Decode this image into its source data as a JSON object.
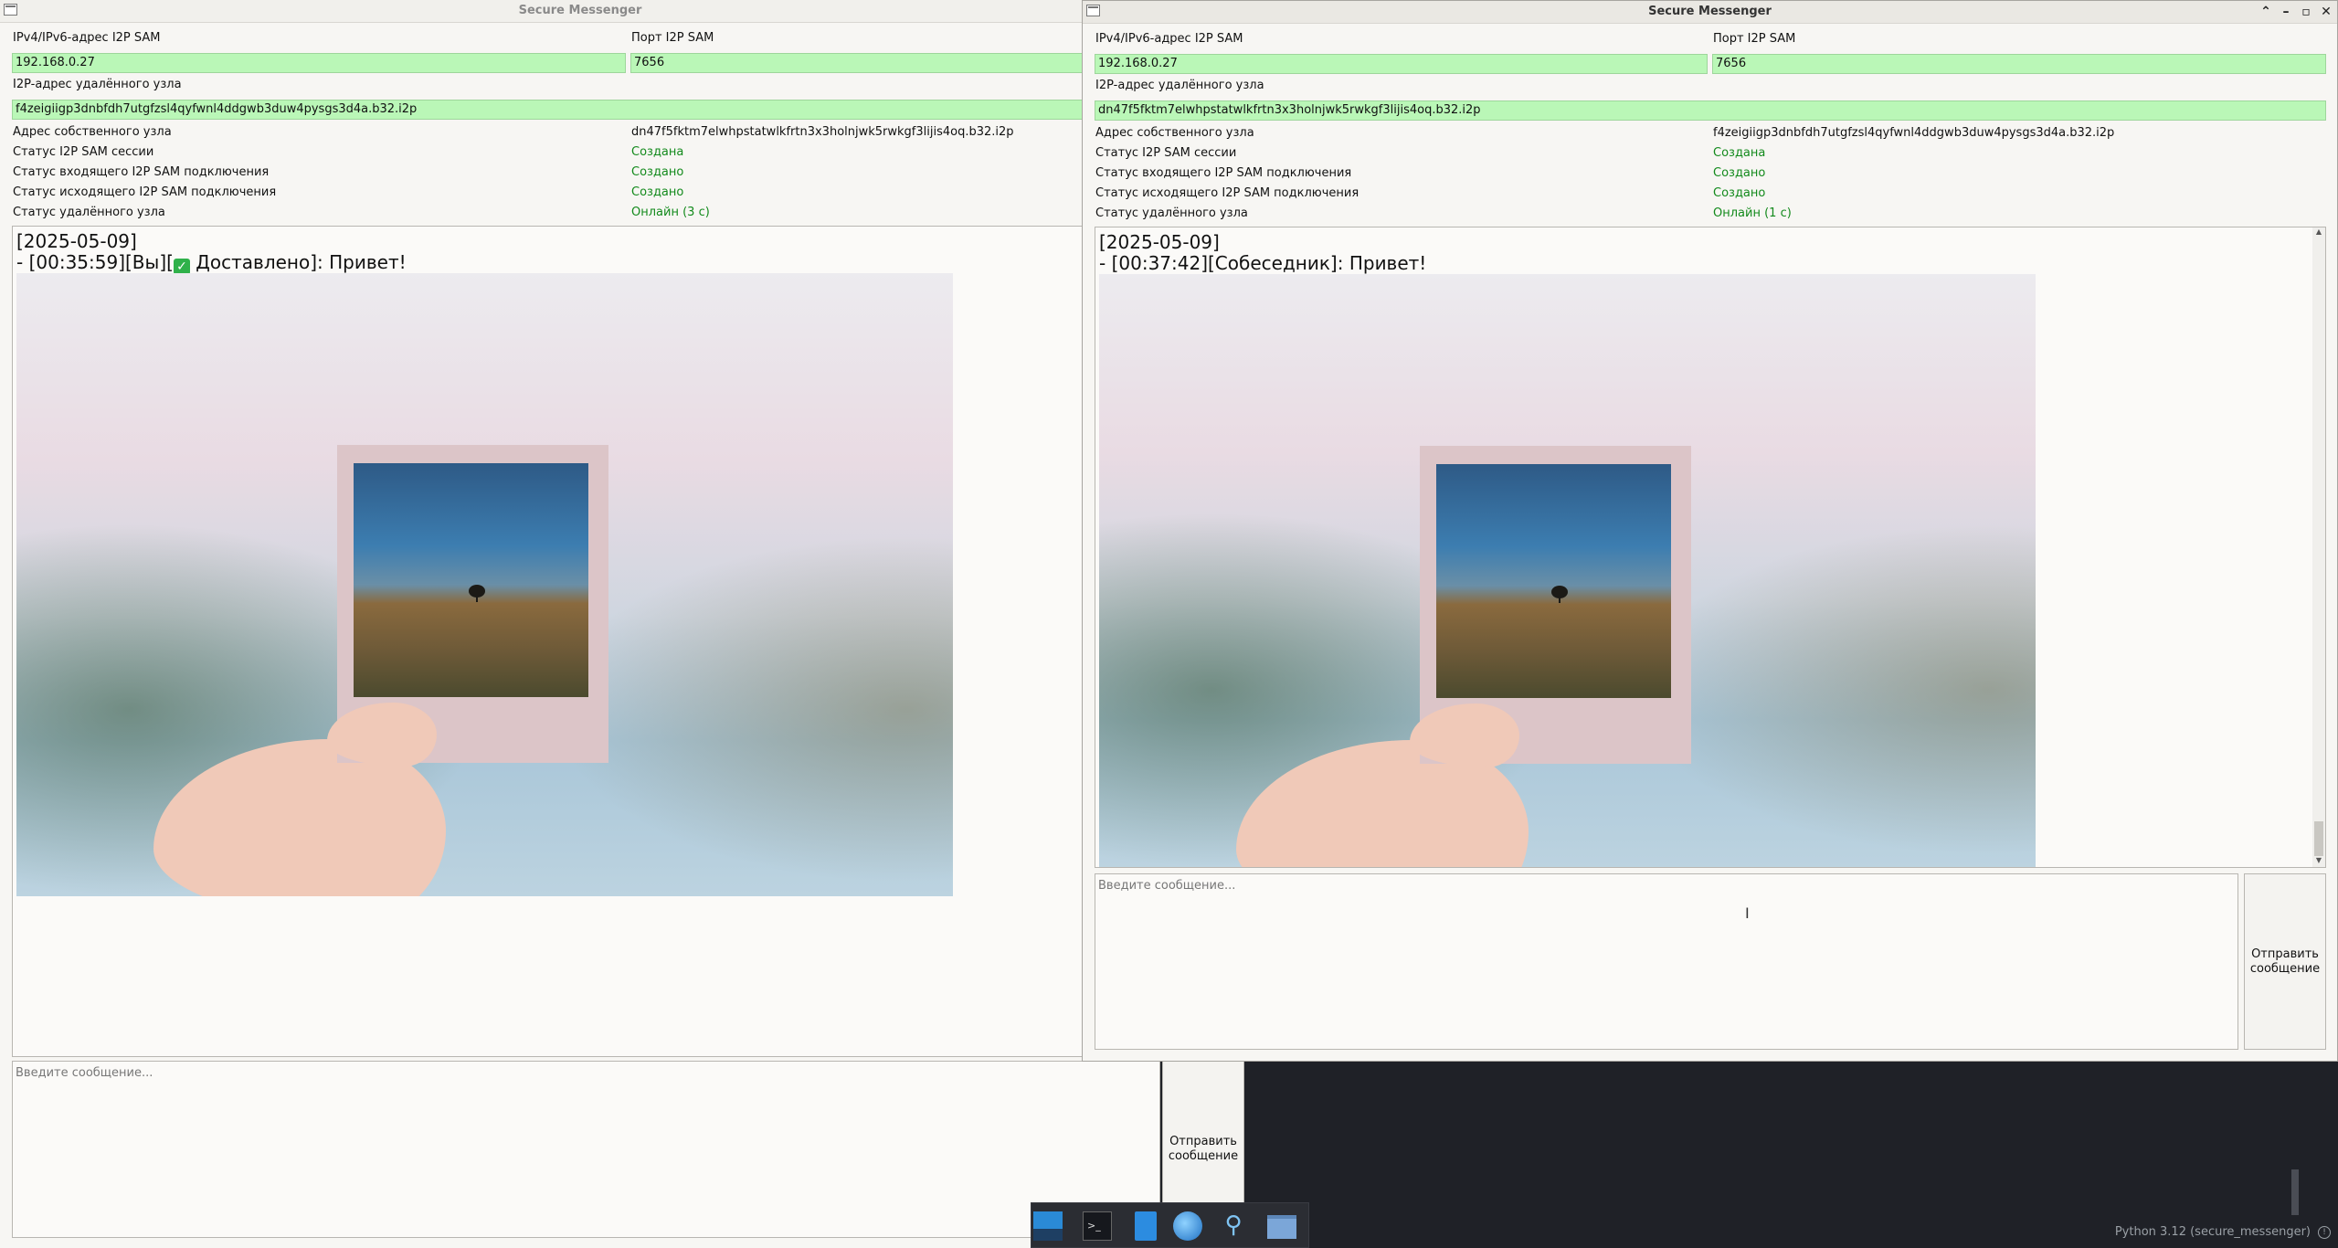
{
  "left_window": {
    "title": "Secure Messenger",
    "sam_address_label": "IPv4/IPv6-адрес I2P SAM",
    "sam_address_value": "192.168.0.27",
    "sam_port_label": "Порт I2P SAM",
    "sam_port_value": "7656",
    "remote_label": "I2P-адрес удалённого узла",
    "remote_value": "f4zeigiigp3dnbfdh7utgfzsl4qyfwnl4ddgwb3duw4pysgs3d4a.b32.i2p",
    "own_label": "Адрес собственного узла",
    "own_value": "dn47f5fktm7elwhpstatwlkfrtn3x3holnjwk5rwkgf3lijis4oq.b32.i2p",
    "session_label": "Статус I2P SAM сессии",
    "session_value": "Создана",
    "incoming_label": "Статус входящего I2P SAM подключения",
    "incoming_value": "Создано",
    "outgoing_label": "Статус исходящего I2P SAM подключения",
    "outgoing_value": "Создано",
    "remote_status_label": "Статус удалённого узла",
    "remote_status_value": "Онлайн (3 с)",
    "chat_date": "[2025-05-09]",
    "chat_prefix": "- [00:35:59][Вы][",
    "chat_delivered": "Доставлено]: Привет!",
    "input_placeholder": "Введите сообщение...",
    "send_label": "Отправить сообщение"
  },
  "right_window": {
    "title": "Secure Messenger",
    "sam_address_label": "IPv4/IPv6-адрес I2P SAM",
    "sam_address_value": "192.168.0.27",
    "sam_port_label": "Порт I2P SAM",
    "sam_port_value": "7656",
    "remote_label": "I2P-адрес удалённого узла",
    "remote_value": "dn47f5fktm7elwhpstatwlkfrtn3x3holnjwk5rwkgf3lijis4oq.b32.i2p",
    "own_label": "Адрес собственного узла",
    "own_value": "f4zeigiigp3dnbfdh7utgfzsl4qyfwnl4ddgwb3duw4pysgs3d4a.b32.i2p",
    "session_label": "Статус I2P SAM сессии",
    "session_value": "Создана",
    "incoming_label": "Статус входящего I2P SAM подключения",
    "incoming_value": "Создано",
    "outgoing_label": "Статус исходящего I2P SAM подключения",
    "outgoing_value": "Создано",
    "remote_status_label": "Статус удалённого узла",
    "remote_status_value": "Онлайн (1 с)",
    "chat_date": "[2025-05-09]",
    "chat_message": "- [00:37:42][Собеседник]: Привет!",
    "input_placeholder": "Введите сообщение...",
    "send_label": "Отправить сообщение"
  },
  "background": {
    "status_text": "Python 3.12 (secure_messenger)"
  },
  "colors": {
    "field_green": "#baf7b7",
    "status_green": "#138a1c",
    "editor_bg": "#1f2127"
  },
  "icons": [
    "window-menu-icon",
    "minimize-icon",
    "maximize-icon",
    "close-icon",
    "checkmark-icon",
    "desktop-icon",
    "terminal-icon",
    "text-editor-icon",
    "browser-icon",
    "search-icon",
    "folder-icon",
    "warning-icon",
    "text-cursor-icon"
  ]
}
